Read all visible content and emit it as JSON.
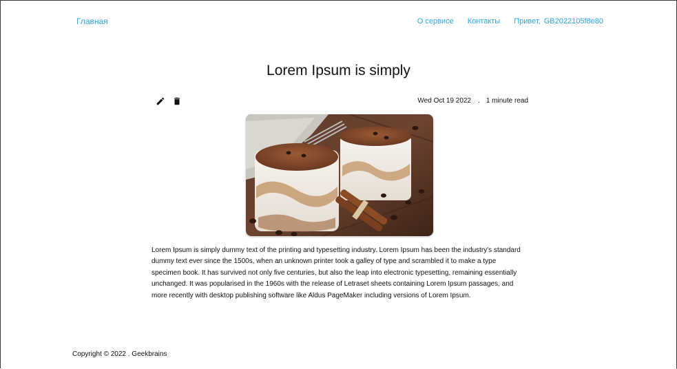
{
  "nav": {
    "home_label": "Главная",
    "service_label": "О сервисе",
    "contacts_label": "Контакты",
    "greeting_prefix": "Привет,",
    "username": "GB2022105f8e80"
  },
  "post": {
    "title": "Lorem Ipsum is simply",
    "date": "Wed Oct 19 2022",
    "separator": ".",
    "read_time": "1 minute read",
    "image_alt": "Tiramisu dessert in glasses with coffee beans and cinnamon",
    "body": "Lorem Ipsum is simply dummy text of the printing and typesetting industry. Lorem Ipsum has been the industry's standard dummy text ever since the 1500s, when an unknown printer took a galley of type and scrambled it to make a type specimen book. It has survived not only five centuries, but also the leap into electronic typesetting, remaining essentially unchanged. It was popularised in the 1960s with the release of Letraset sheets containing Lorem Ipsum passages, and more recently with desktop publishing software like Aldus PageMaker including versions of Lorem Ipsum."
  },
  "footer": {
    "copyright": "Copyright © 2022 . Geekbrains"
  },
  "icons": {
    "edit": "pencil-icon",
    "delete": "trash-icon"
  },
  "colors": {
    "link": "#2aa7e6",
    "text": "#111111",
    "background": "#ffffff"
  }
}
